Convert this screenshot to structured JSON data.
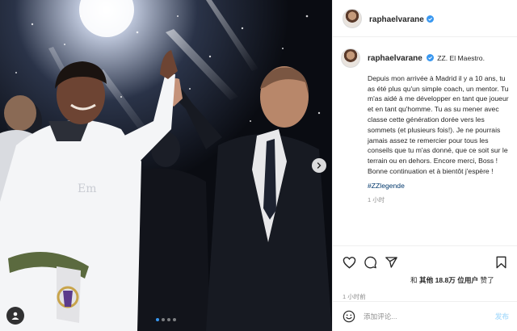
{
  "post": {
    "username": "raphaelvarane",
    "verified": true,
    "caption_lead": "ZZ. El Maestro.",
    "caption_body": "Depuis mon arrivée à Madrid il y a 10 ans, tu as été plus qu'un simple coach, un mentor. Tu m'as aidé à me développer en tant que joueur et en tant qu'homme. Tu as su mener avec classe cette génération dorée vers les sommets (et plusieurs fois!). Je ne pourrais jamais assez te remercier pour tous les conseils que tu m'as donné, que ce soit sur le terrain ou en dehors. Encore merci, Boss !\nBonne continuation et à bientôt j'espère !",
    "hashtag": "#ZZlegende",
    "caption_time": "1 小时",
    "likes_prefix": "和",
    "likes_others": "其他 18.8万 位用户",
    "likes_suffix": "赞了",
    "post_time": "1 小时前",
    "comment_placeholder": "添加评论...",
    "post_button": "发布",
    "carousel": {
      "total": 4,
      "active": 1
    }
  },
  "icons": {
    "heart": "heart-icon",
    "comment": "comment-icon",
    "share": "paper-plane-icon",
    "save": "bookmark-icon",
    "emoji": "emoji-icon",
    "next": "chevron-right-icon",
    "tag": "user-tag-icon",
    "verified": "verified-badge-icon"
  },
  "colors": {
    "link": "#00376b",
    "secondary": "#8e8e8e",
    "border": "#efefef",
    "verified": "#3897f0",
    "post_button_disabled": "#b2dffc"
  }
}
